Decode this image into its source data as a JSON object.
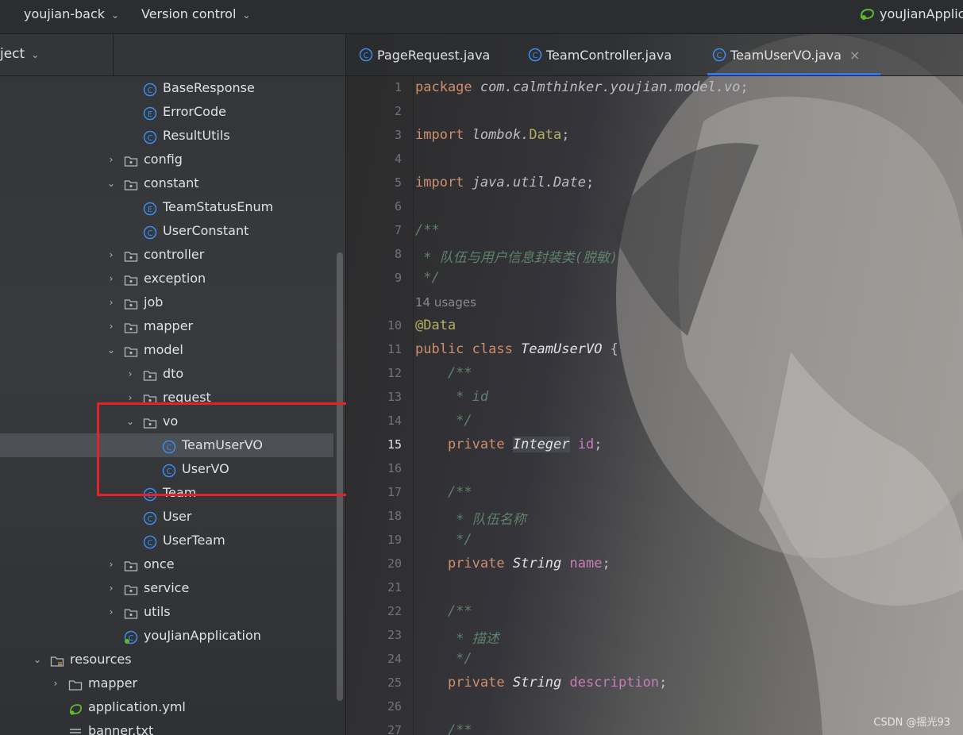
{
  "topbar": {
    "project_menu": "youjian-back",
    "vcs_menu": "Version control",
    "run_config": "youJianApplic"
  },
  "panel": {
    "title": "ject"
  },
  "tree": [
    {
      "label": "BaseResponse",
      "icon": "class-icon",
      "arrow": "",
      "depth": 3
    },
    {
      "label": "ErrorCode",
      "icon": "enum-icon",
      "arrow": "",
      "depth": 3
    },
    {
      "label": "ResultUtils",
      "icon": "class-icon",
      "arrow": "",
      "depth": 3
    },
    {
      "label": "config",
      "icon": "package-icon",
      "arrow": "›",
      "depth": 2
    },
    {
      "label": "constant",
      "icon": "package-icon",
      "arrow": "⌄",
      "depth": 2
    },
    {
      "label": "TeamStatusEnum",
      "icon": "enum-icon",
      "arrow": "",
      "depth": 3
    },
    {
      "label": "UserConstant",
      "icon": "class-icon",
      "arrow": "",
      "depth": 3
    },
    {
      "label": "controller",
      "icon": "package-icon",
      "arrow": "›",
      "depth": 2
    },
    {
      "label": "exception",
      "icon": "package-icon",
      "arrow": "›",
      "depth": 2
    },
    {
      "label": "job",
      "icon": "package-icon",
      "arrow": "›",
      "depth": 2
    },
    {
      "label": "mapper",
      "icon": "package-icon",
      "arrow": "›",
      "depth": 2
    },
    {
      "label": "model",
      "icon": "package-icon",
      "arrow": "⌄",
      "depth": 2
    },
    {
      "label": "dto",
      "icon": "package-icon",
      "arrow": "›",
      "depth": 3
    },
    {
      "label": "request",
      "icon": "package-icon",
      "arrow": "›",
      "depth": 3
    },
    {
      "label": "vo",
      "icon": "package-icon",
      "arrow": "⌄",
      "depth": 3
    },
    {
      "label": "TeamUserVO",
      "icon": "class-icon",
      "arrow": "",
      "depth": 4,
      "selected": true
    },
    {
      "label": "UserVO",
      "icon": "class-icon",
      "arrow": "",
      "depth": 4
    },
    {
      "label": "Team",
      "icon": "class-icon",
      "arrow": "",
      "depth": 3
    },
    {
      "label": "User",
      "icon": "class-icon",
      "arrow": "",
      "depth": 3
    },
    {
      "label": "UserTeam",
      "icon": "class-icon",
      "arrow": "",
      "depth": 3
    },
    {
      "label": "once",
      "icon": "package-icon",
      "arrow": "›",
      "depth": 2
    },
    {
      "label": "service",
      "icon": "package-icon",
      "arrow": "›",
      "depth": 2
    },
    {
      "label": "utils",
      "icon": "package-icon",
      "arrow": "›",
      "depth": 2
    },
    {
      "label": "youJianApplication",
      "icon": "spring-class-icon",
      "arrow": "",
      "depth": 2
    },
    {
      "label": "resources",
      "icon": "resources-folder-icon",
      "arrow": "⌄",
      "depth": 0
    },
    {
      "label": "mapper",
      "icon": "folder-icon",
      "arrow": "›",
      "depth": 1
    },
    {
      "label": "application.yml",
      "icon": "spring-config-icon",
      "arrow": "",
      "depth": 1
    },
    {
      "label": "banner.txt",
      "icon": "text-file-icon",
      "arrow": "",
      "depth": 1
    }
  ],
  "tabs": [
    {
      "label": "PageRequest.java",
      "active": false
    },
    {
      "label": "TeamController.java",
      "active": false
    },
    {
      "label": "TeamUserVO.java",
      "active": true,
      "close": "×"
    }
  ],
  "gutter": [
    "1",
    "2",
    "3",
    "4",
    "5",
    "6",
    "7",
    "8",
    "9",
    "10",
    "11",
    "12",
    "13",
    "14",
    "15",
    "16",
    "17",
    "18",
    "19",
    "20",
    "21",
    "22",
    "23",
    "24",
    "25",
    "26",
    "27"
  ],
  "current_line": "15",
  "code": {
    "pkg_kw": "package",
    "pkg_name": "com.calmthinker.youjian.model.vo",
    "import_kw": "import",
    "imp1_pkg": "lombok.",
    "imp1_cls": "Data",
    "imp2": "java.util.Date",
    "doc_open": "/**",
    "doc_text": " * 队伍与用户信息封装类(脱敏)",
    "doc_close": " */",
    "usages": "14 usages",
    "annotation": "@Data",
    "class_mods": "public class",
    "class_name": "TeamUserVO",
    "brace": " {",
    "f1_doc_open": "    /**",
    "f1_doc_text": "     * id",
    "f1_doc_close": "     */",
    "private_kw": "private",
    "f1_type": "Integer",
    "f1_name": "id",
    "f2_doc_open": "    /**",
    "f2_doc_text": "     * 队伍名称",
    "f2_doc_close": "     */",
    "f2_type": "String",
    "f2_name": "name",
    "f3_doc_open": "    /**",
    "f3_doc_text": "     * 描述",
    "f3_doc_close": "     */",
    "f3_type": "String",
    "f3_name": "description",
    "f4_doc_open": "    /**",
    "semicolon": ";"
  },
  "watermark": "CSDN @摇光93",
  "colors": {
    "accent": "#3574f0",
    "class_icon": "#3d8cf0",
    "highlight": "#e2232a",
    "keyword": "#cf8e6d",
    "comment": "#5f826b"
  }
}
